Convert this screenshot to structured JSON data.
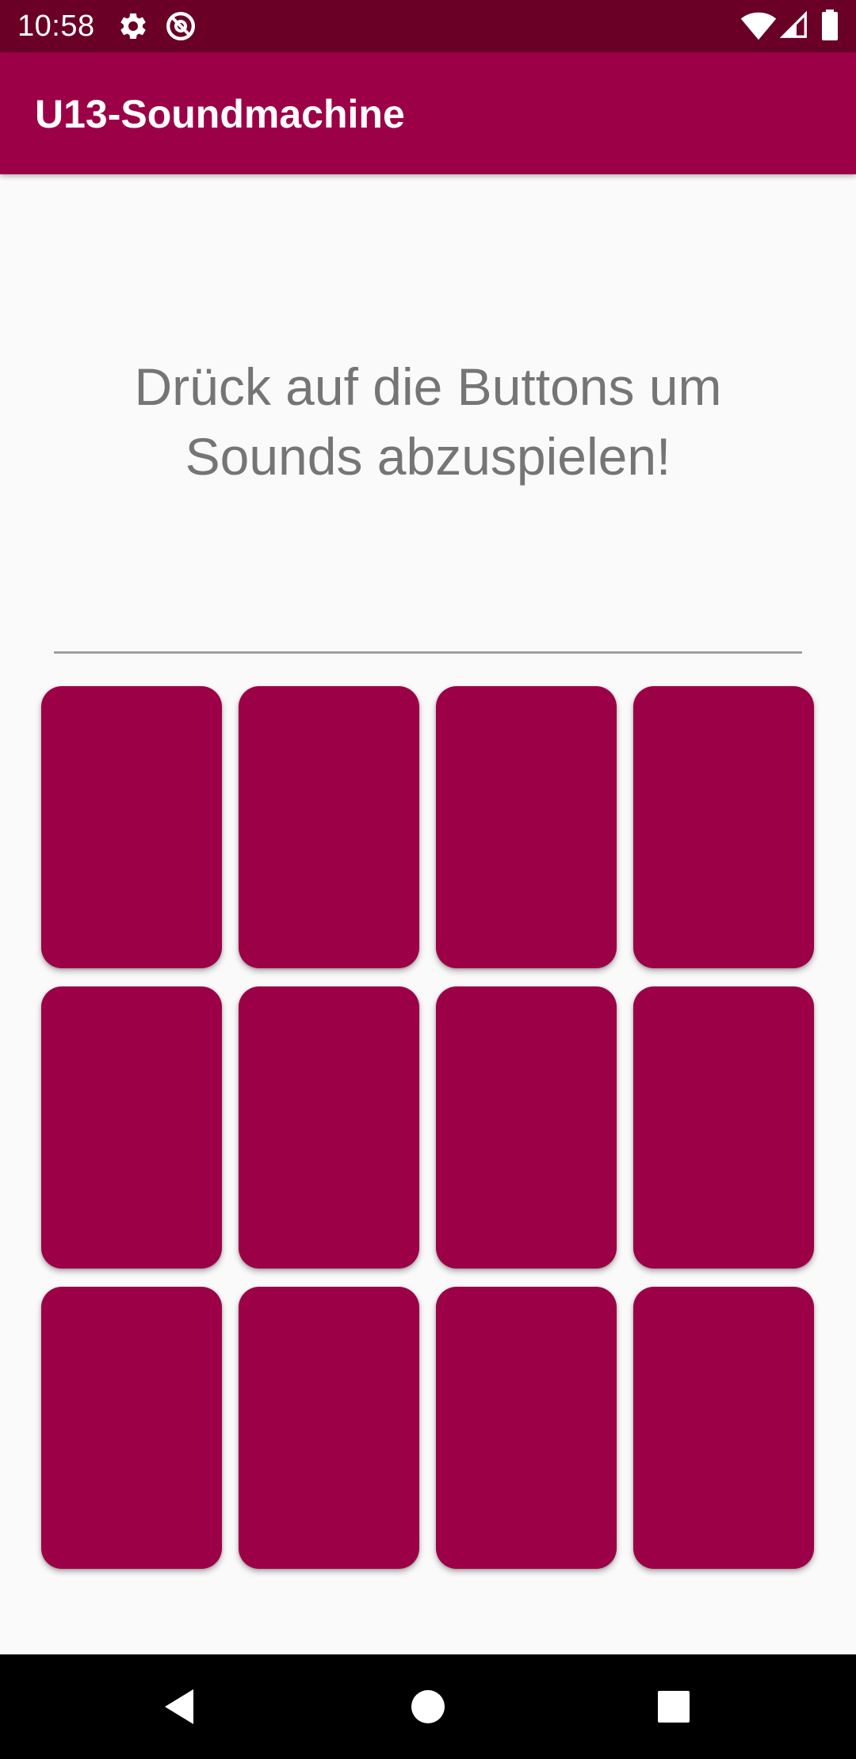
{
  "status_bar": {
    "time": "10:58",
    "background": "#6a0026",
    "icons": [
      "gear-icon",
      "at-sign-icon",
      "wifi-icon",
      "signal-icon",
      "battery-icon"
    ]
  },
  "app_bar": {
    "title": "U13-Soundmachine",
    "background": "#9c0047"
  },
  "main": {
    "instruction": "Drück auf die Buttons um Sounds abzuspielen!",
    "button_color": "#9c0047",
    "sound_buttons": [
      "",
      "",
      "",
      "",
      "",
      "",
      "",
      "",
      "",
      "",
      "",
      ""
    ]
  },
  "nav_bar": {
    "icons": [
      "back-icon",
      "home-icon",
      "recents-icon"
    ]
  }
}
